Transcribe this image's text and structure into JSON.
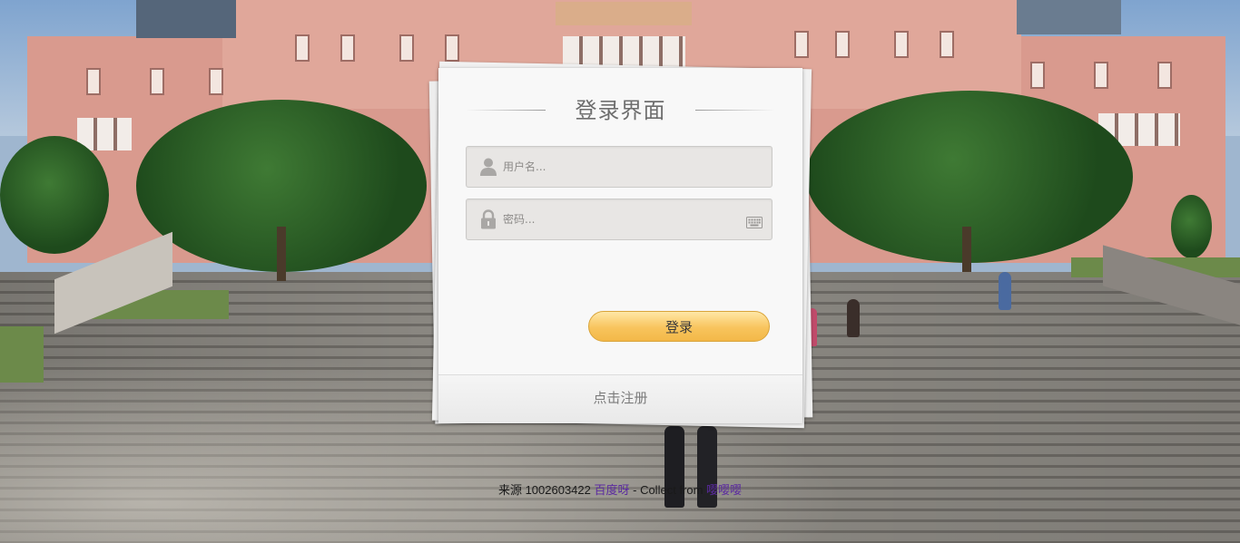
{
  "login": {
    "title": "登录界面",
    "username_placeholder": "用户名...",
    "password_placeholder": "密码...",
    "submit_label": "登录",
    "register_label": "点击注册"
  },
  "credit": {
    "prefix": "来源 1002603422",
    "link1": "百度呀",
    "middle": " - Collect from ",
    "link2": "嘤嘤嘤"
  },
  "icons": {
    "user": "user-icon",
    "lock": "lock-icon",
    "keyboard": "keyboard-icon"
  },
  "colors": {
    "button_gradient_top": "#ffe7a6",
    "button_gradient_bottom": "#f3b848",
    "card_background": "#f8f8f8",
    "field_background": "#e8e6e4",
    "link": "#5b2aa0"
  }
}
